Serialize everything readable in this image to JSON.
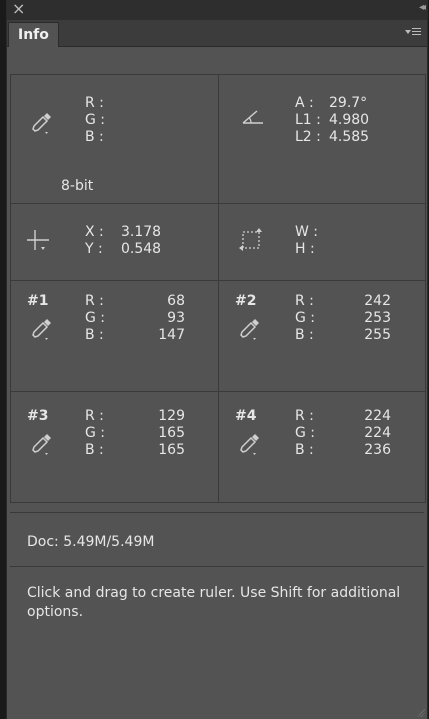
{
  "panel": {
    "tab_label": "Info",
    "close_glyph": "×",
    "collapse_glyph": "◂◂"
  },
  "color_readout": {
    "r_label": "R :",
    "g_label": "G :",
    "b_label": "B :",
    "bit_depth": "8-bit"
  },
  "ruler": {
    "a_label": "A :",
    "a_value": "29.7°",
    "l1_label": "L1 :",
    "l1_value": "4.980",
    "l2_label": "L2 :",
    "l2_value": "4.585"
  },
  "position": {
    "x_label": "X :",
    "x_value": "3.178",
    "y_label": "Y :",
    "y_value": "0.548"
  },
  "size": {
    "w_label": "W :",
    "h_label": "H :"
  },
  "samplers": [
    {
      "num": "#1",
      "r": "68",
      "g": "93",
      "b": "147"
    },
    {
      "num": "#2",
      "r": "242",
      "g": "253",
      "b": "255"
    },
    {
      "num": "#3",
      "r": "129",
      "g": "165",
      "b": "165"
    },
    {
      "num": "#4",
      "r": "224",
      "g": "224",
      "b": "236"
    }
  ],
  "sampler_labels": {
    "r": "R :",
    "g": "G :",
    "b": "B :"
  },
  "doc": "Doc: 5.49M/5.49M",
  "hint": "Click and drag to create ruler.  Use Shift for additional options.",
  "colors": {
    "panel_bg": "#535353",
    "titlebar_bg": "#2e2e2e",
    "text": "#e6e6e6"
  }
}
